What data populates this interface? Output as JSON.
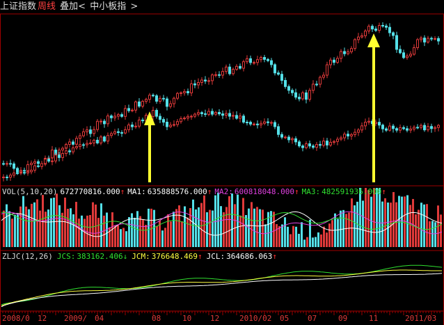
{
  "header": {
    "index_name": "上证指数",
    "period": "周线",
    "overlay": "叠加<",
    "overlay_target": "中小板指",
    "arrow": ">"
  },
  "vol_panel": {
    "title": "VOL(5,10,20)",
    "value": "672770816.000",
    "value_arrow": "↑",
    "ma1_label": "MA1:",
    "ma1_value": "635888576.000",
    "ma1_arrow": "↑",
    "ma2_label": "MA2:",
    "ma2_value": "600818048.000",
    "ma2_arrow": "↑",
    "ma3_label": "MA3:",
    "ma3_value": "482591936.000",
    "ma3_arrow": "↑"
  },
  "zljc_panel": {
    "title": "ZLJC(12,26)",
    "jcs_label": "JCS:",
    "jcs_value": "383162.406",
    "jcs_arrow": "↓",
    "jcm_label": "JCM:",
    "jcm_value": "376648.469",
    "jcm_arrow": "↑",
    "jcl_label": "JCL:",
    "jcl_value": "364686.063",
    "jcl_arrow": "↑"
  },
  "time_axis": [
    "2008/0",
    "12",
    "2009/",
    "04",
    "08",
    "10",
    "12",
    "2010/02",
    "05",
    "07",
    "09",
    "11",
    "2011/",
    "03"
  ],
  "colors": {
    "up": "#e03a3a",
    "down": "#54e0e8",
    "ma1": "#ffffff",
    "ma2": "#e040e0",
    "ma3": "#30e030",
    "jcs": "#30e030",
    "jcm": "#ffff40",
    "jcl": "#ffffff",
    "arrow": "#ffff30",
    "grid": "#a00000"
  }
}
